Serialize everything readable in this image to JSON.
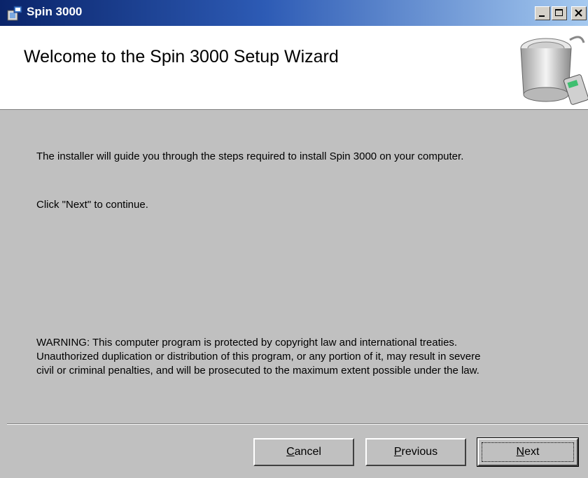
{
  "window": {
    "title": "Spin 3000",
    "controls": [
      "minimize-icon",
      "maximize-icon",
      "close-icon"
    ]
  },
  "banner": {
    "title": "Welcome to the Spin 3000 Setup Wizard"
  },
  "content": {
    "intro": "The installer will guide you through the steps required to install Spin 3000 on your computer.",
    "instruction": "Click \"Next\" to continue.",
    "warning_lines": [
      "WARNING: This computer program is protected by copyright law and international treaties.",
      "Unauthorized duplication or distribution of this program, or any portion of it, may result in severe",
      "civil or criminal penalties, and will be prosecuted to the maximum extent possible under the law."
    ]
  },
  "buttons": {
    "cancel": {
      "mnemonic": "C",
      "rest": "ancel"
    },
    "previous": {
      "mnemonic": "P",
      "rest": "revious"
    },
    "next": {
      "mnemonic": "N",
      "rest": "ext"
    }
  },
  "colors": {
    "titlebar_start": "#0a246a",
    "titlebar_end": "#a6caf0",
    "face": "#c0c0c0"
  }
}
